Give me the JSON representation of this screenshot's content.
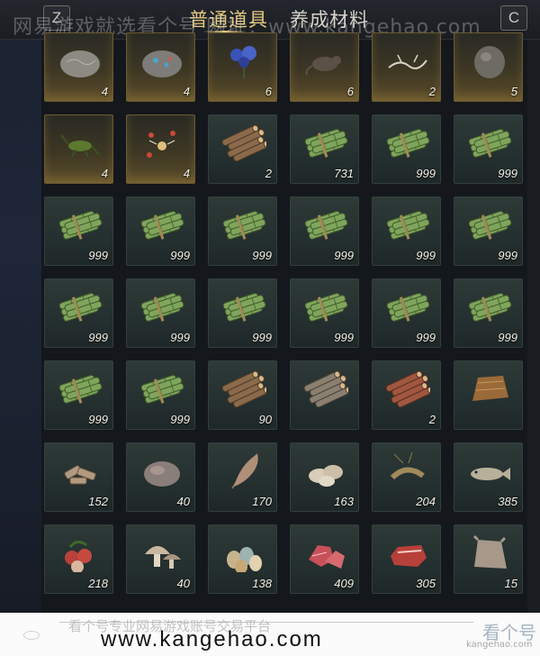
{
  "header": {
    "key_left": "Z",
    "key_right": "C",
    "tabs": [
      {
        "label": "普通道具",
        "active": true
      },
      {
        "label": "养成材料",
        "active": false
      }
    ],
    "watermark": "网易游戏就选看个号 网址：www.kangehao.com"
  },
  "inventory": {
    "items": [
      {
        "icon": "stone-icon",
        "count": "4",
        "rarity": "gold"
      },
      {
        "icon": "ore-stone-icon",
        "count": "4",
        "rarity": "gold"
      },
      {
        "icon": "blue-herb-icon",
        "count": "6",
        "rarity": "gold"
      },
      {
        "icon": "rat-icon",
        "count": "6",
        "rarity": "gold"
      },
      {
        "icon": "branch-icon",
        "count": "2",
        "rarity": "gold"
      },
      {
        "icon": "rock-icon",
        "count": "5",
        "rarity": "gold"
      },
      {
        "icon": "cricket-icon",
        "count": "4",
        "rarity": "gold"
      },
      {
        "icon": "firefly-icon",
        "count": "4",
        "rarity": "gold"
      },
      {
        "icon": "log-bundle-icon",
        "count": "2",
        "rarity": "normal"
      },
      {
        "icon": "bamboo-bundle-icon",
        "count": "731",
        "rarity": "normal"
      },
      {
        "icon": "bamboo-bundle-icon",
        "count": "999",
        "rarity": "normal"
      },
      {
        "icon": "bamboo-bundle-icon",
        "count": "999",
        "rarity": "normal"
      },
      {
        "icon": "bamboo-bundle-icon",
        "count": "999",
        "rarity": "normal"
      },
      {
        "icon": "bamboo-bundle-icon",
        "count": "999",
        "rarity": "normal"
      },
      {
        "icon": "bamboo-bundle-icon",
        "count": "999",
        "rarity": "normal"
      },
      {
        "icon": "bamboo-bundle-icon",
        "count": "999",
        "rarity": "normal"
      },
      {
        "icon": "bamboo-bundle-icon",
        "count": "999",
        "rarity": "normal"
      },
      {
        "icon": "bamboo-bundle-icon",
        "count": "999",
        "rarity": "normal"
      },
      {
        "icon": "bamboo-bundle-icon",
        "count": "999",
        "rarity": "normal"
      },
      {
        "icon": "bamboo-bundle-icon",
        "count": "999",
        "rarity": "normal"
      },
      {
        "icon": "bamboo-bundle-icon",
        "count": "999",
        "rarity": "normal"
      },
      {
        "icon": "bamboo-bundle-icon",
        "count": "999",
        "rarity": "normal"
      },
      {
        "icon": "bamboo-bundle-icon",
        "count": "999",
        "rarity": "normal"
      },
      {
        "icon": "bamboo-bundle-icon",
        "count": "999",
        "rarity": "normal"
      },
      {
        "icon": "bamboo-bundle-icon",
        "count": "999",
        "rarity": "normal"
      },
      {
        "icon": "bamboo-bundle-icon",
        "count": "999",
        "rarity": "normal"
      },
      {
        "icon": "log-bundle-icon",
        "count": "90",
        "rarity": "normal"
      },
      {
        "icon": "gray-log-bundle-icon",
        "count": "",
        "rarity": "normal"
      },
      {
        "icon": "red-log-bundle-icon",
        "count": "2",
        "rarity": "normal"
      },
      {
        "icon": "fur-pelt-icon",
        "count": "",
        "rarity": "normal"
      },
      {
        "icon": "wood-chips-icon",
        "count": "152",
        "rarity": "normal"
      },
      {
        "icon": "ore-icon",
        "count": "40",
        "rarity": "normal"
      },
      {
        "icon": "feather-icon",
        "count": "170",
        "rarity": "normal"
      },
      {
        "icon": "shells-icon",
        "count": "163",
        "rarity": "normal"
      },
      {
        "icon": "shrimp-icon",
        "count": "204",
        "rarity": "normal"
      },
      {
        "icon": "fish-icon",
        "count": "385",
        "rarity": "normal"
      },
      {
        "icon": "lychee-icon",
        "count": "218",
        "rarity": "normal"
      },
      {
        "icon": "mushroom-icon",
        "count": "40",
        "rarity": "normal"
      },
      {
        "icon": "eggs-icon",
        "count": "138",
        "rarity": "normal"
      },
      {
        "icon": "raw-meat-icon",
        "count": "409",
        "rarity": "normal"
      },
      {
        "icon": "steak-icon",
        "count": "305",
        "rarity": "normal"
      },
      {
        "icon": "hide-icon",
        "count": "15",
        "rarity": "normal"
      }
    ]
  },
  "footer": {
    "tagline": "看个号专业网易游戏账号交易平台",
    "url": "www.kangehao.com",
    "brand": "看个号",
    "brand_url": "kangehao.com"
  }
}
